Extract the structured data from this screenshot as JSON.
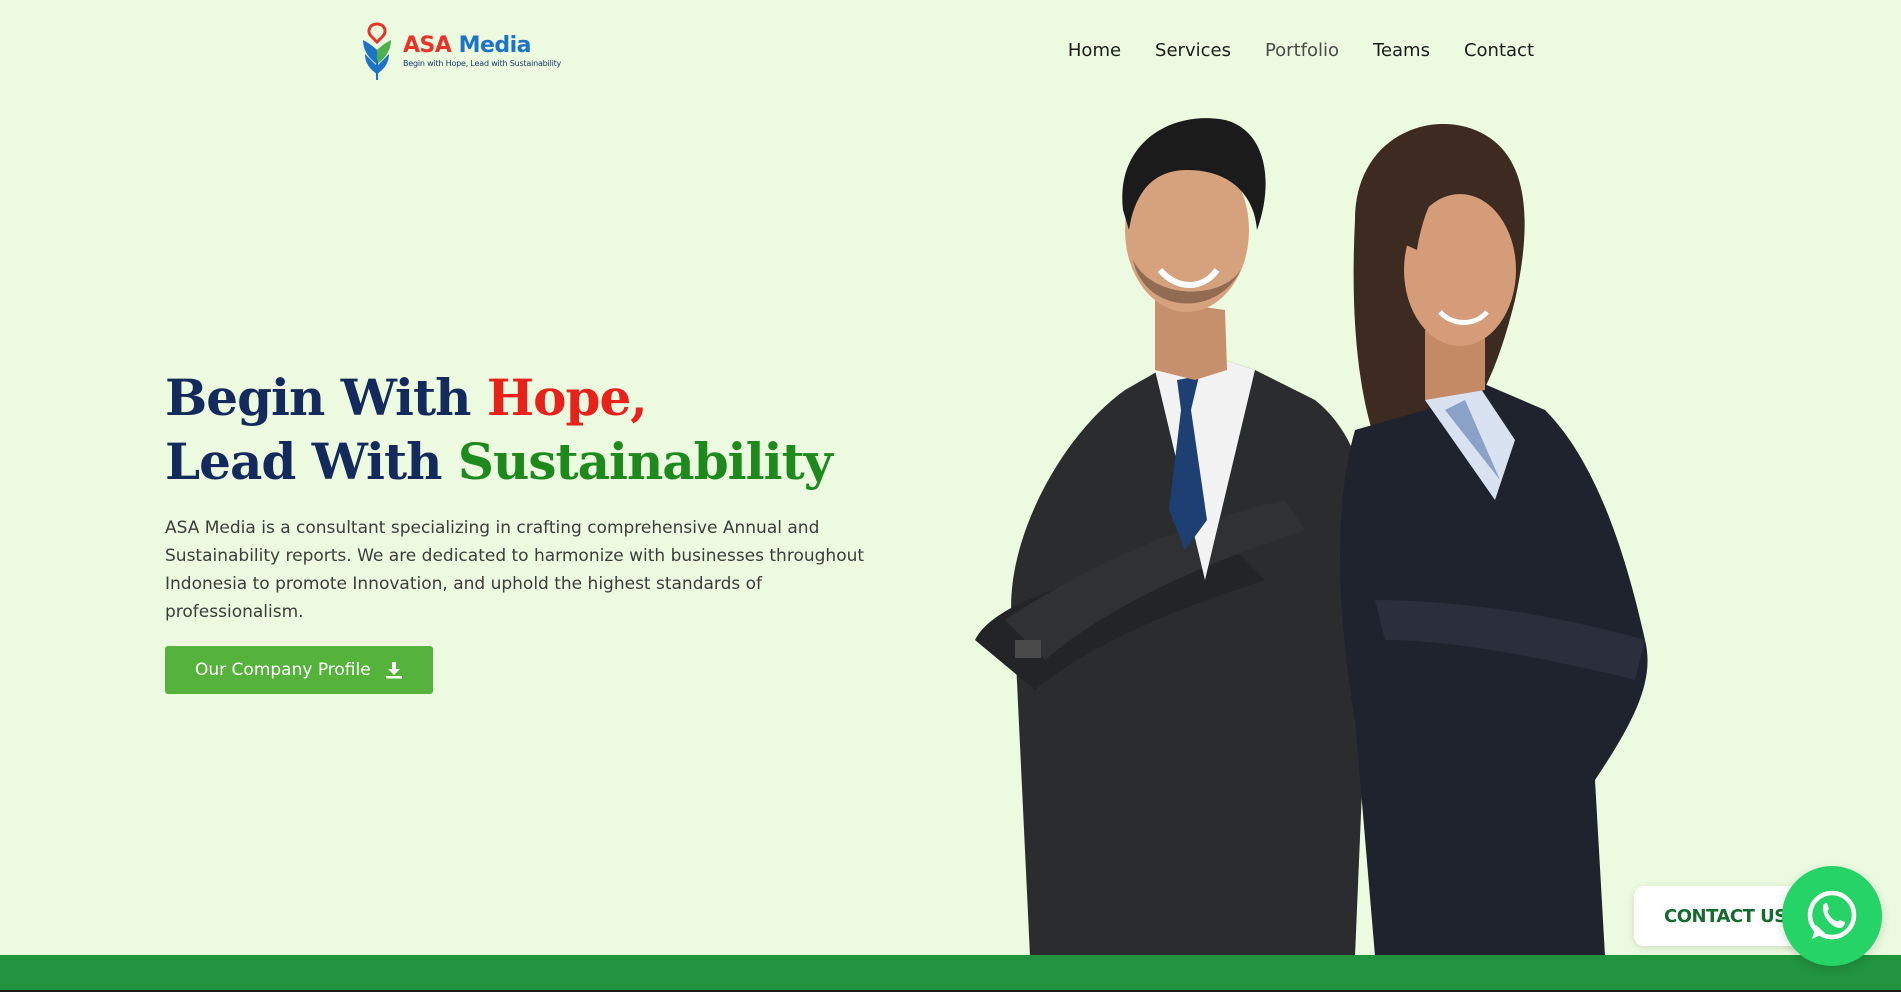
{
  "logo": {
    "name_part1": "ASA",
    "name_part2": "Media",
    "tagline": "Begin with Hope, Lead with Sustainability"
  },
  "nav": {
    "items": [
      {
        "label": "Home"
      },
      {
        "label": "Services"
      },
      {
        "label": "Portfolio"
      },
      {
        "label": "Teams"
      },
      {
        "label": "Contact"
      }
    ],
    "active": "Portfolio"
  },
  "hero": {
    "line1_prefix": "Begin With ",
    "line1_highlight": "Hope,",
    "line2_prefix": "Lead With ",
    "line2_highlight": "Sustainability",
    "description": "ASA Media is a consultant specializing in crafting comprehensive Annual and Sustainability reports. We are dedicated to harmonize with businesses throughout Indonesia to promote Innovation, and uphold the highest standards of professionalism.",
    "cta_label": "Our Company Profile"
  },
  "floating": {
    "contact_label": "CONTACT US"
  },
  "colors": {
    "background": "#ecfadf",
    "heading": "#152a5c",
    "accent_red": "#e8211a",
    "accent_green": "#1e8a1e",
    "button": "#55b33b",
    "whatsapp": "#25d366",
    "footer_band": "#22943f"
  },
  "icons": {
    "cta": "download-icon",
    "whatsapp": "whatsapp-icon",
    "logo": "leaf-logo-icon"
  }
}
